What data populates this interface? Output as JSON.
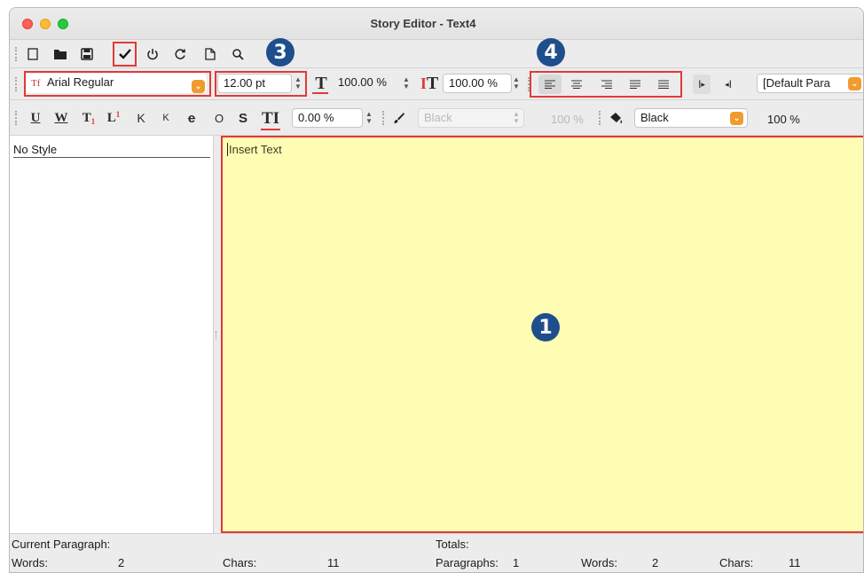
{
  "window": {
    "title": "Story Editor - Text4"
  },
  "toolbar1": {
    "icons": [
      "new-document-icon",
      "open-folder-icon",
      "save-icon",
      "apply-checkmark-icon",
      "power-icon",
      "refresh-icon",
      "page-icon",
      "search-icon"
    ]
  },
  "toolbar2": {
    "font_prefix": "Tf",
    "font_name": "Arial Regular",
    "font_size": "12.00 pt",
    "horizontal_scale": "100.00 %",
    "vertical_scale": "100.00 %",
    "paragraph_style": "[Default Para"
  },
  "toolbar3": {
    "tracking": "0.00 %",
    "stroke_color": "Black",
    "stroke_opacity": "100 %",
    "fill_color": "Black",
    "fill_opacity": "100 %"
  },
  "callouts": {
    "editor": "1",
    "font_size": "3",
    "alignment": "4"
  },
  "style_list": {
    "items": [
      "No Style"
    ]
  },
  "editor": {
    "text": "Insert Text"
  },
  "status": {
    "current_paragraph_label": "Current Paragraph:",
    "totals_label": "Totals:",
    "words_label": "Words:",
    "words_value": "2",
    "chars_label": "Chars:",
    "chars_value": "11",
    "paragraphs_label": "Paragraphs:",
    "paragraphs_value": "1",
    "total_words_label": "Words:",
    "total_words_value": "2",
    "total_chars_label": "Chars:",
    "total_chars_value": "11"
  },
  "colors": {
    "editor_bg": "#fffdb4",
    "highlight": "#e03a3a",
    "callout": "#1f4e8c",
    "dropdown": "#f29a2e"
  }
}
